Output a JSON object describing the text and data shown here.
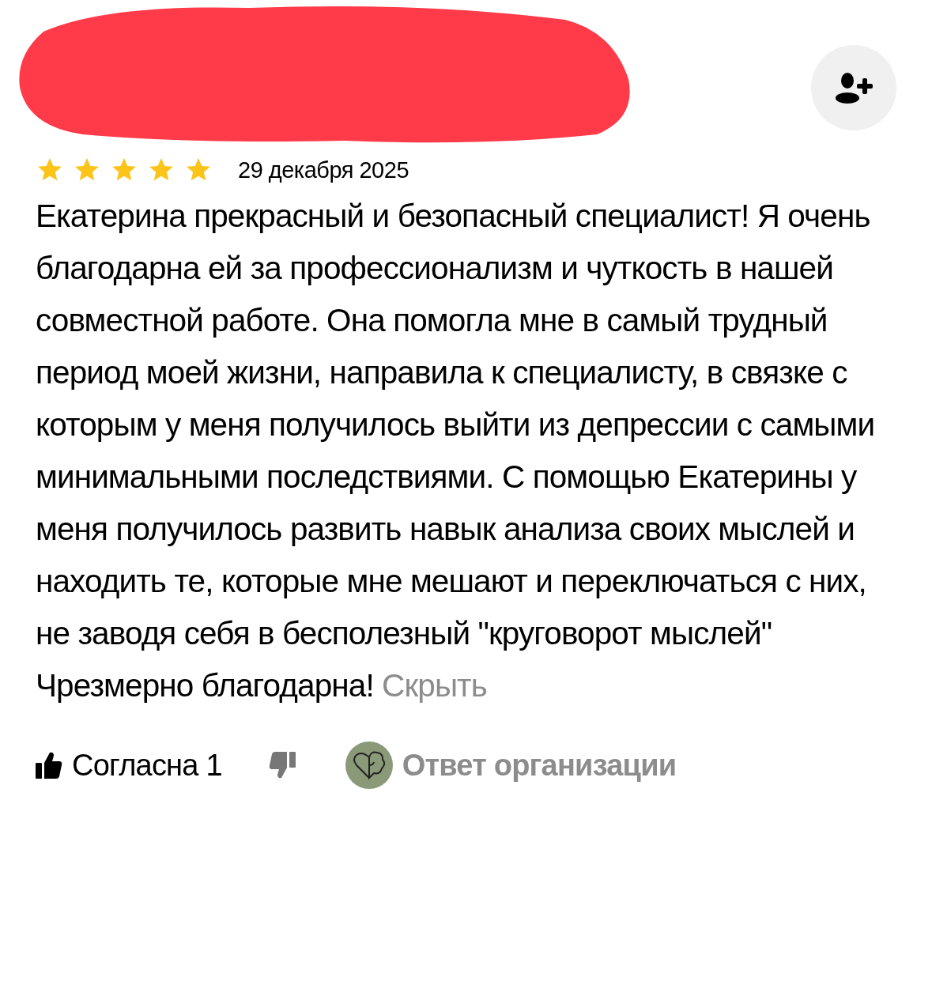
{
  "review": {
    "stars": 5,
    "date": "29 декабря 2025",
    "text": "Екатерина прекрасный и безопасный специалист! Я очень благодарна ей за профессионализм и чуткость в нашей совместной работе. Она помогла мне в самый трудный период моей жизни, направила к специалисту, в связке с которым у меня получилось выйти из депрессии с самыми минимальными последствиями. С помощью Екатерины у меня получилось развить навык анализа своих мыслей и находить те, которые мне мешают и переключаться с них, не заводя себя в бесполезный \"круговорот мыслей\" Чрезмерно благодарна!",
    "collapse_link": "Скрыть"
  },
  "actions": {
    "like_label": "Согласна 1",
    "org_reply": "Ответ организации"
  }
}
